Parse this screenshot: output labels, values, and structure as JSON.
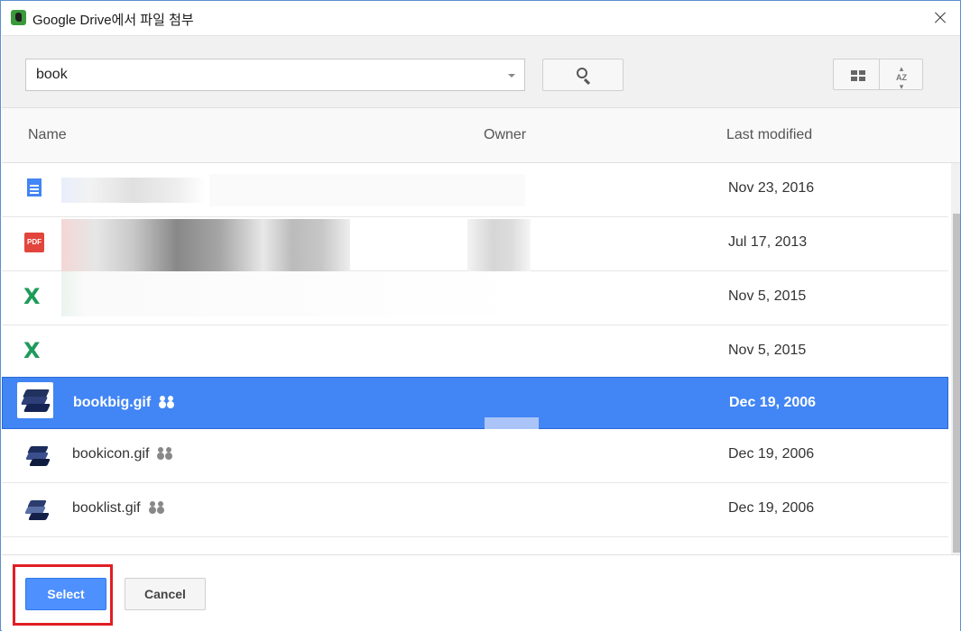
{
  "window": {
    "title": "Google Drive에서 파일 첨부"
  },
  "search": {
    "value": "book"
  },
  "columns": {
    "name": "Name",
    "owner": "Owner",
    "modified": "Last modified"
  },
  "files": [
    {
      "name": "",
      "icon": "google-doc-icon",
      "modified": "Nov 23, 2016",
      "shared": false
    },
    {
      "name": "",
      "icon": "pdf-icon",
      "modified": "Jul 17, 2013",
      "shared": false
    },
    {
      "name": "",
      "icon": "sheets-icon",
      "modified": "Nov 5, 2015",
      "shared": false
    },
    {
      "name": "",
      "icon": "sheets-icon",
      "modified": "Nov 5, 2015",
      "shared": false
    },
    {
      "name": "bookbig.gif",
      "icon": "image-icon",
      "modified": "Dec 19, 2006",
      "shared": true,
      "selected": true
    },
    {
      "name": "bookicon.gif",
      "icon": "image-icon",
      "modified": "Dec 19, 2006",
      "shared": true
    },
    {
      "name": "booklist.gif",
      "icon": "image-icon",
      "modified": "Dec 19, 2006",
      "shared": true
    }
  ],
  "footer": {
    "select_label": "Select",
    "cancel_label": "Cancel"
  },
  "colors": {
    "accent": "#4285f4",
    "highlight": "#e01e24"
  }
}
